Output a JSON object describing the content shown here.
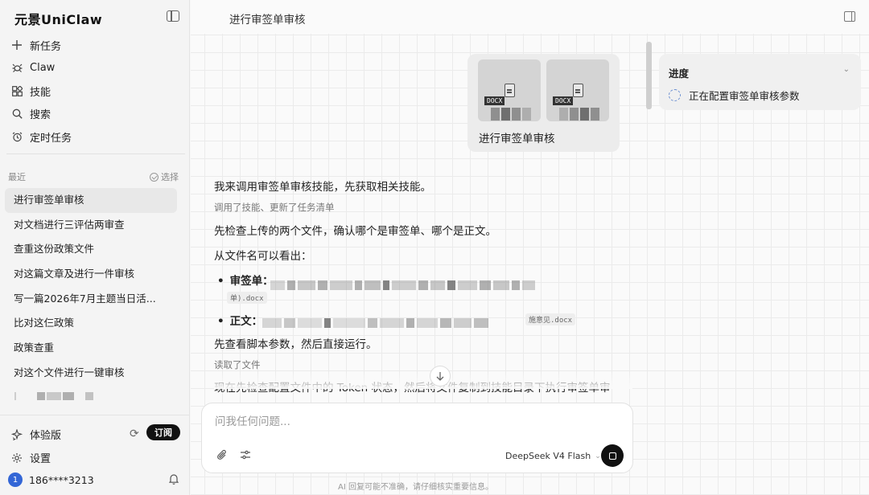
{
  "sidebar": {
    "brand": "元景UniClaw",
    "nav": [
      {
        "icon": "plus-icon",
        "label": "新任务"
      },
      {
        "icon": "claw-icon",
        "label": "Claw"
      },
      {
        "icon": "skills-icon",
        "label": "技能"
      },
      {
        "icon": "search-icon",
        "label": "搜索"
      },
      {
        "icon": "alarm-clock-icon",
        "label": "定时任务"
      }
    ],
    "recent_label": "最近",
    "select_label": "选择",
    "history": [
      "进行审签单审核",
      "对文档进行三评估两审查",
      "查重这份政策文件",
      "对这篇文章及进行一件审核",
      "写一篇2026年7月主题当日活...",
      "比对这仨政策",
      "政策查重",
      "对这个文件进行一键审核"
    ],
    "active_history_index": 0,
    "trial_label": "体验版",
    "subscribe_label": "订阅",
    "settings_label": "设置",
    "user": {
      "avatar": "1",
      "phone": "186****3213"
    }
  },
  "main": {
    "title": "进行审签单审核",
    "attachments": {
      "label": "进行审签单审核",
      "files": [
        {
          "type": "DOCX"
        },
        {
          "type": "DOCX"
        }
      ]
    },
    "progress": {
      "title": "进度",
      "status": "正在配置审签单审核参数"
    },
    "messages": {
      "m1": "我来调用审签单审核技能，先获取相关技能。",
      "m1_meta": "调用了技能、更新了任务清单",
      "m2": "先检查上传的两个文件，确认哪个是审签单、哪个是正文。",
      "m3": "从文件名可以看出：",
      "b1_label": "审签单：",
      "b1_chip": "单).docx",
      "b2_label": "正文：",
      "b2_chip": "施意见.docx",
      "m4": "先查看脚本参数，然后直接运行。",
      "m4_meta": "读取了文件",
      "m5": "现在先检查配置文件中的 Token 状态，然后将文件复制到技能目录下执行审签单审"
    },
    "composer": {
      "placeholder": "问我任何问题...",
      "model": "DeepSeek V4 Flash"
    },
    "disclaimer": "AI 回复可能不准确，请仔细核实重要信息。"
  },
  "colors": {
    "accent_dark": "#111111",
    "avatar_blue": "#3366d6",
    "spinner_blue": "#6a8fd1"
  }
}
